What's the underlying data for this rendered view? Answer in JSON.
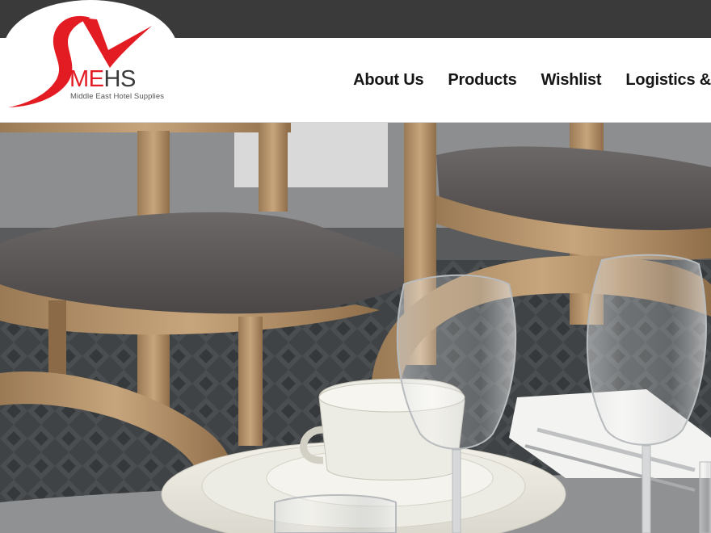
{
  "header": {
    "logo": {
      "text_me": "ME",
      "text_hs": "HS",
      "tagline": "Middle East Hotel Supplies"
    },
    "nav": [
      {
        "label": "About Us"
      },
      {
        "label": "Products"
      },
      {
        "label": "Wishlist"
      },
      {
        "label": "Logistics &"
      }
    ]
  },
  "colors": {
    "topbar": "#3a3a3a",
    "brand_red": "#e31b23",
    "nav_text": "#151515"
  },
  "hero": {
    "image": "restaurant table setting with wooden chairs, plates, cup and wine glasses"
  }
}
